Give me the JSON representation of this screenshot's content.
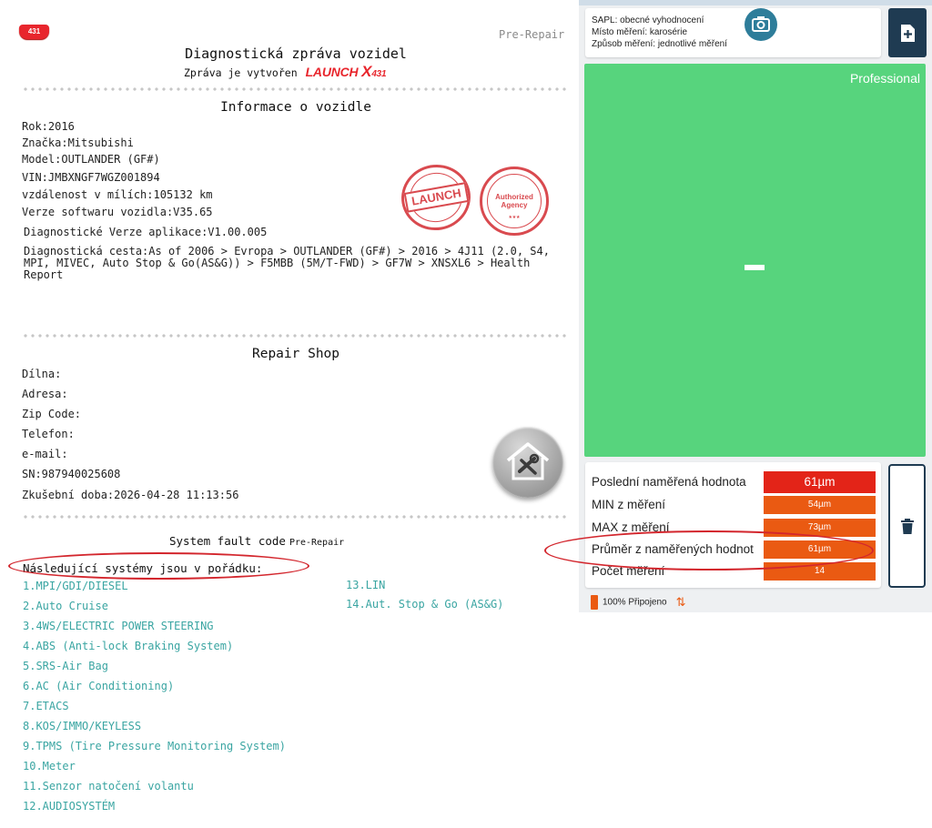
{
  "report": {
    "badge": "431",
    "pre_repair": "Pre-Repair",
    "title": "Diagnostická zpráva vozidel",
    "subtitle": "Zpráva je vytvořen",
    "brand": "LAUNCH",
    "brand_x": "X",
    "brand_num": "431",
    "vehicle_section": "Informace o vozidle",
    "vehicle": {
      "year": "Rok:2016",
      "make": "Značka:Mitsubishi",
      "model": "Model:OUTLANDER (GF#)",
      "vin": "VIN:JMBXNGF7WGZ001894",
      "mileage": "vzdálenost v mílích:105132 km",
      "sw_version": "Verze softwaru vozidla:V35.65",
      "app_version": "Diagnostické Verze aplikace:V1.00.005",
      "path": "Diagnostická cesta:As of 2006 > Evropa > OUTLANDER (GF#) > 2016 > 4J11 (2.0, S4, MPI, MIVEC, Auto Stop & Go(AS&G)) > F5MBB (5M/T-FWD) > GF7W > XNSXL6 > Health Report"
    },
    "stamps": {
      "launch": "LAUNCH",
      "authorized": "Authorized Agency",
      "stars": "★★★"
    },
    "shop_section": "Repair Shop",
    "shop": {
      "workshop": "Dílna:",
      "address": "Adresa:",
      "zip": "Zip Code:",
      "phone": "Telefon:",
      "email": "e-mail:",
      "sn": "SN:987940025608",
      "test_time": "Zkušební doba:2026-04-28 11:13:56"
    },
    "fault_title": "System fault code",
    "fault_pre": "Pre-Repair",
    "ok_text": "Následující systémy jsou v pořádku:",
    "systems_left": [
      "1.MPI/GDI/DIESEL",
      "2.Auto Cruise",
      "3.4WS/ELECTRIC POWER STEERING",
      "4.ABS (Anti-lock Braking System)",
      "5.SRS-Air Bag",
      "6.AC (Air Conditioning)",
      "7.ETACS",
      "8.KOS/IMMO/KEYLESS",
      "9.TPMS (Tire Pressure Monitoring System)",
      "10.Meter",
      "11.Senzor natočení volantu",
      "12.AUDIOSYSTÉM"
    ],
    "systems_right": [
      "13.LIN",
      "14.Aut. Stop & Go (AS&G)"
    ]
  },
  "app": {
    "info": {
      "line1": "SAPL: obecné vyhodnocení",
      "line2": "Místo měření: karosérie",
      "line3": "Způsob měření: jednotlivé měření"
    },
    "mode": "Professional",
    "stats": [
      {
        "label": "Poslední naměřená hodnota",
        "value": "61µm"
      },
      {
        "label": "MIN z měření",
        "value": "54µm"
      },
      {
        "label": "MAX z měření",
        "value": "73µm"
      },
      {
        "label": "Průměr z naměřených hodnot",
        "value": "61µm"
      },
      {
        "label": "Počet měření",
        "value": "14"
      }
    ],
    "status": "100% Připojeno",
    "accent": "#ea5a12",
    "green": "#57d47d"
  }
}
